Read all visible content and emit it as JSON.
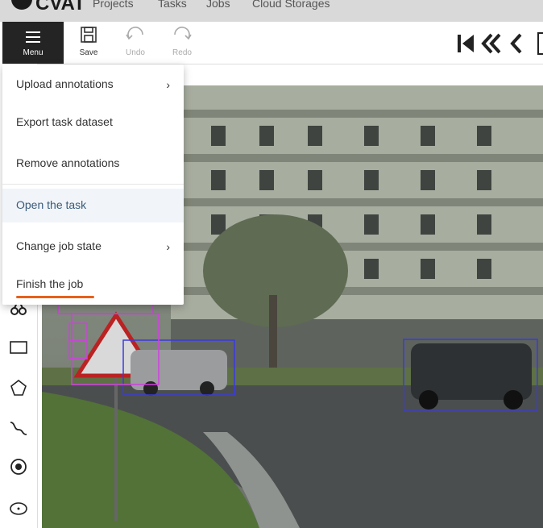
{
  "app": {
    "logo_text": "CVAT"
  },
  "topnav": {
    "items": [
      "Projects",
      "Tasks",
      "Jobs",
      "Cloud Storages"
    ]
  },
  "toolbar": {
    "menu_label": "Menu",
    "save_label": "Save",
    "undo_label": "Undo",
    "redo_label": "Redo"
  },
  "menu": {
    "items": [
      {
        "label": "Upload annotations",
        "has_submenu": true
      },
      {
        "label": "Export task dataset",
        "has_submenu": false
      },
      {
        "label": "Remove annotations",
        "has_submenu": false
      },
      {
        "label": "Open the task",
        "has_submenu": false,
        "state": "hovered"
      },
      {
        "label": "Change job state",
        "has_submenu": true
      },
      {
        "label": "Finish the job",
        "has_submenu": false,
        "state": "highlighted"
      }
    ]
  },
  "sidebar": {
    "icons": [
      "cursor-icon",
      "rectangle-icon",
      "polygon-icon",
      "polyline-icon",
      "point-icon",
      "ellipse-icon"
    ]
  },
  "colors": {
    "menu_bg": "#242424",
    "highlight_underline": "#e8601c",
    "box_blue": "#3a3ae0",
    "box_magenta": "#d040e0"
  }
}
